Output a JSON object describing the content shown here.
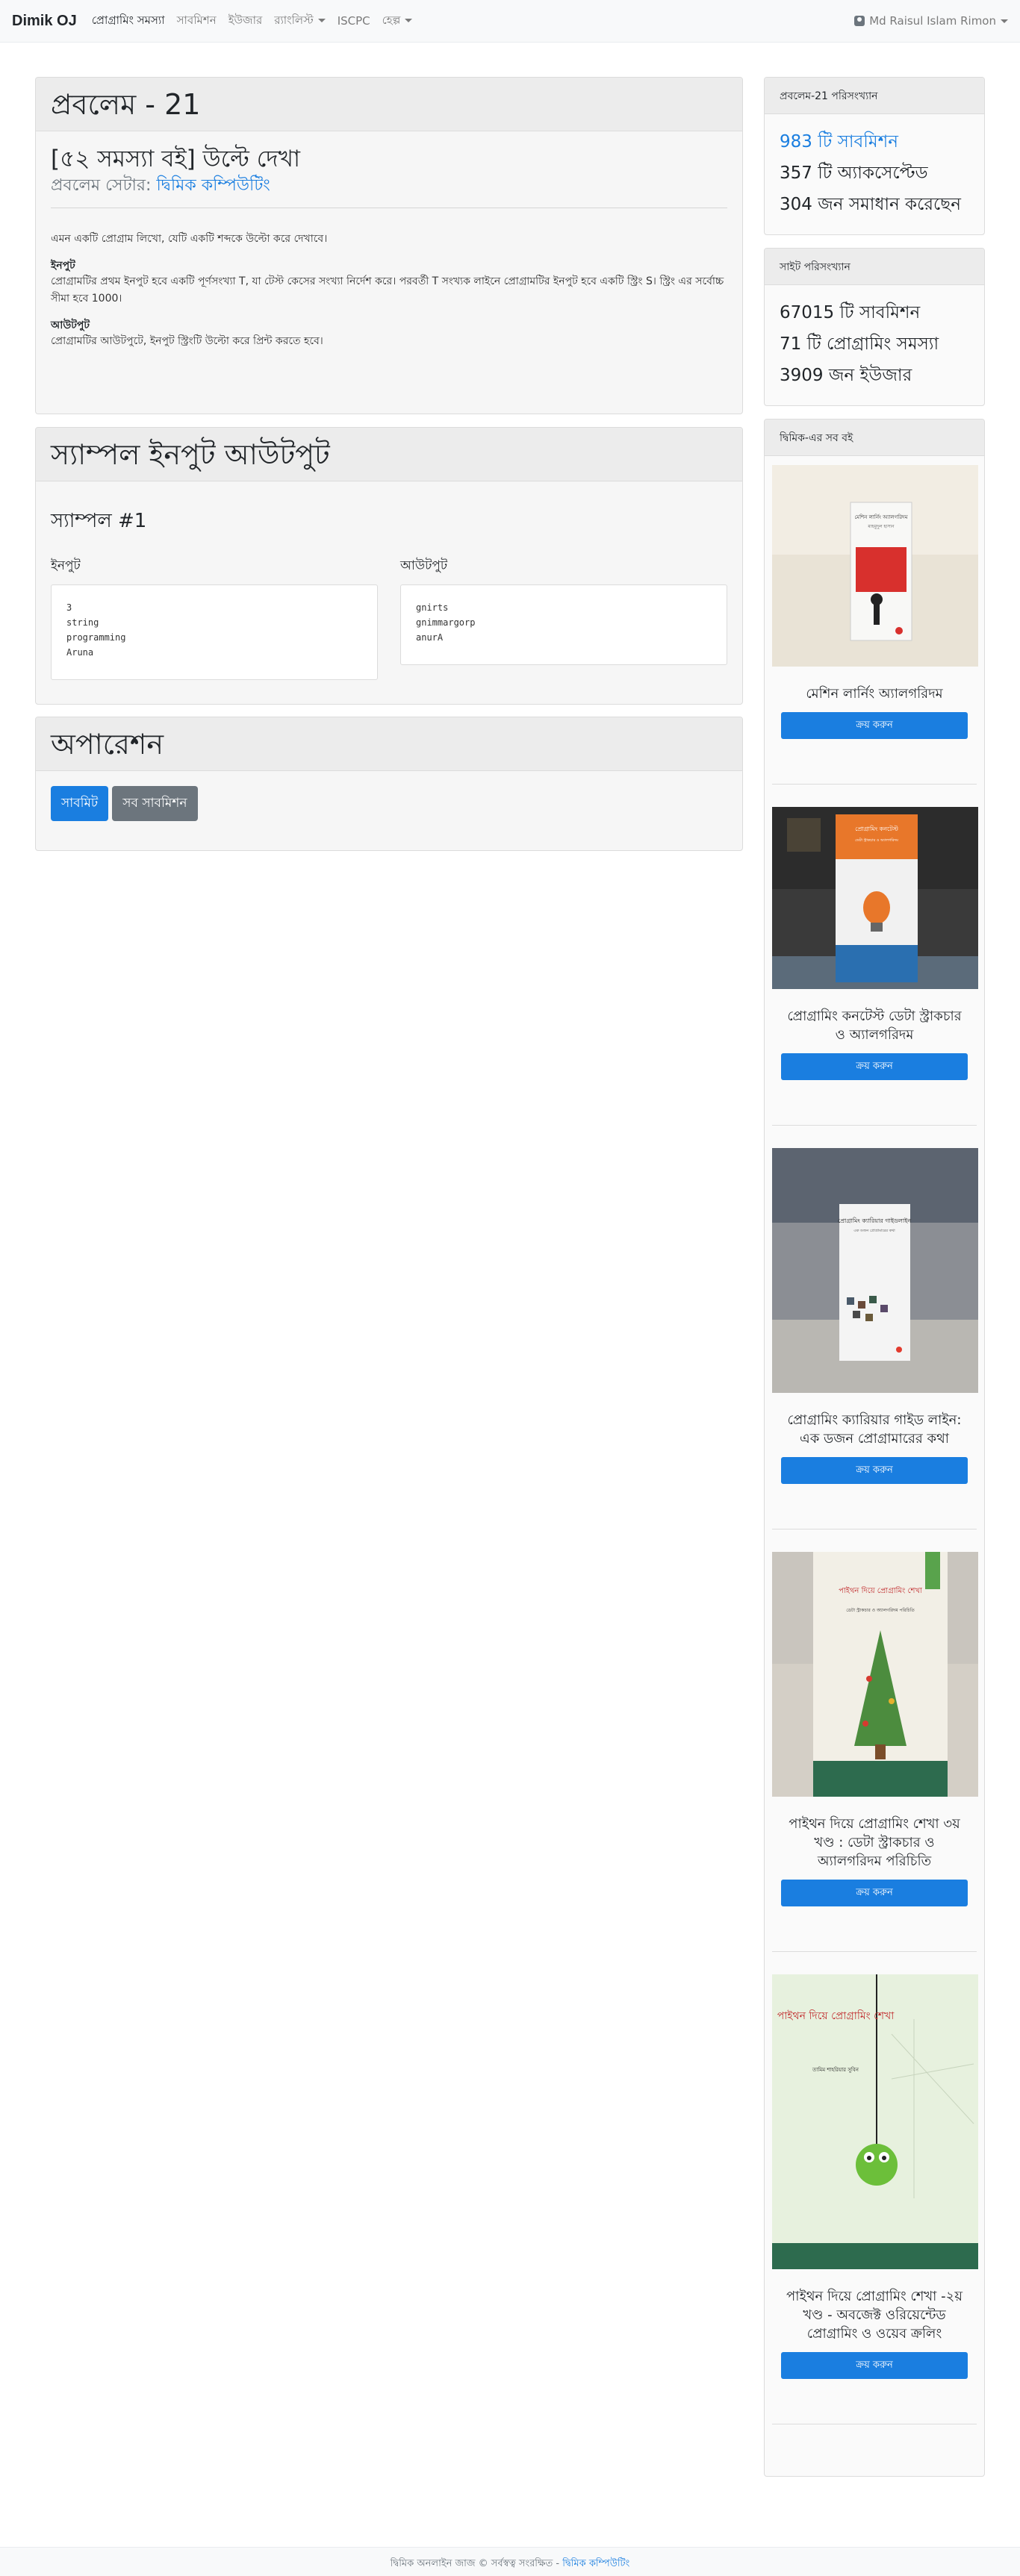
{
  "navbar": {
    "brand": "Dimik OJ",
    "links": [
      "প্রোগ্রামিং সমস্যা",
      "সাবমিশন",
      "ইউজার",
      "র‍্যাংলিস্ট",
      "ISCPC",
      "হেল্প"
    ],
    "user": "Md Raisul Islam Rimon"
  },
  "problem": {
    "header": "প্রবলেম - 21",
    "title": "[৫২ সমস্যা বই] উল্টে দেখা",
    "setter_label": "প্রবলেম সেটার:",
    "setter_name": "দ্বিমিক কম্পিউটিং",
    "description": "এমন একটি প্রোগ্রাম লিখো, যেটি একটি শব্দকে উল্টো করে দেখাবে।",
    "input_title": "ইনপুট",
    "input_text": "প্রোগ্রামটির প্রথম ইনপুট হবে একটি পূর্ণসংখ্যা T, যা টেস্ট কেসের সংখ্যা নির্দেশ করে। পরবর্তী T সংখ্যক লাইনে প্রোগ্রামটির ইনপুট হবে একটি স্ট্রিং S। স্ট্রিং এর সর্বোচ্চ সীমা হবে 1000।",
    "output_title": "আউটপুট",
    "output_text": "প্রোগ্রামটির আউটপুটে, ইনপুট স্ট্রিংটি উল্টো করে প্রিন্ট করতে হবে।"
  },
  "sample": {
    "header": "স্যাম্পল ইনপুট আউটপুট",
    "label": "স্যাম্পল #1",
    "input_label": "ইনপুট",
    "output_label": "আউটপুট",
    "input": "3\nstring\nprogramming\nAruna",
    "output": "gnirts\ngnimmargorp\nanurA"
  },
  "operation": {
    "header": "অপারেশন",
    "submit": "সাবমিট",
    "all_submissions": "সব সাবমিশন"
  },
  "problem_stats": {
    "header": "প্রবলেম-21 পরিসংখ্যান",
    "submissions": "983 টি সাবমিশন",
    "accepted": "357 টি অ্যাকসেপ্টেড",
    "solved": "304 জন সমাধান করেছেন"
  },
  "site_stats": {
    "header": "সাইট পরিসংখ্যান",
    "submissions": "67015 টি সাবমিশন",
    "problems": "71 টি প্রোগ্রামিং সমস্যা",
    "users": "3909 জন ইউজার"
  },
  "books": {
    "header": "দ্বিমিক-এর সব বই",
    "buy_label": "ক্রয় করুন",
    "items": [
      {
        "name": "মেশিন লার্নিং অ্যালগরিদম",
        "cover_title": "মেশিন লার্নিং অ্যালগরিদম",
        "cover_author": "মাহমুদুল হাসান"
      },
      {
        "name": "প্রোগ্রামিং কনটেস্ট ডেটা স্ট্রাকচার ও অ্যালগরিদম",
        "cover_title": "প্রোগ্রামিং কনটেস্ট",
        "cover_author": "ডেটা স্ট্রাকচার ও অ্যালগরিদম"
      },
      {
        "name": "প্রোগ্রামিং ক্যারিয়ার গাইড লাইন: এক ডজন প্রোগ্রামারের কথা",
        "cover_title": "প্রোগ্রামিং ক্যারিয়ার গাইডলাইন",
        "cover_author": "এক ডজন প্রোগ্রামারের কথা"
      },
      {
        "name": "পাইথন দিয়ে প্রোগ্রামিং শেখা ৩য় খণ্ড : ডেটা স্ট্রাকচার ও অ্যালগরিদম পরিচিতি",
        "cover_title": "পাইথন দিয়ে প্রোগ্রামিং শেখা",
        "cover_author": "ডেটা স্ট্রাকচার ও অ্যালগরিদম পরিচিতি"
      },
      {
        "name": "পাইথন দিয়ে প্রোগ্রামিং শেখা -২য় খণ্ড - অবজেক্ট ওরিয়েন্টেড প্রোগ্রামিং ও ওয়েব ক্রলিং",
        "cover_title": "পাইথন দিয়ে প্রোগ্রামিং শেখা",
        "cover_author": "তামিম শাহরিয়ার সুবিন"
      }
    ]
  },
  "footer": {
    "text": "দ্বিমিক অনলাইন জাজ © সর্বস্বত্ব সংরক্ষিত -",
    "link": "দ্বিমিক কম্পিউটিং"
  }
}
